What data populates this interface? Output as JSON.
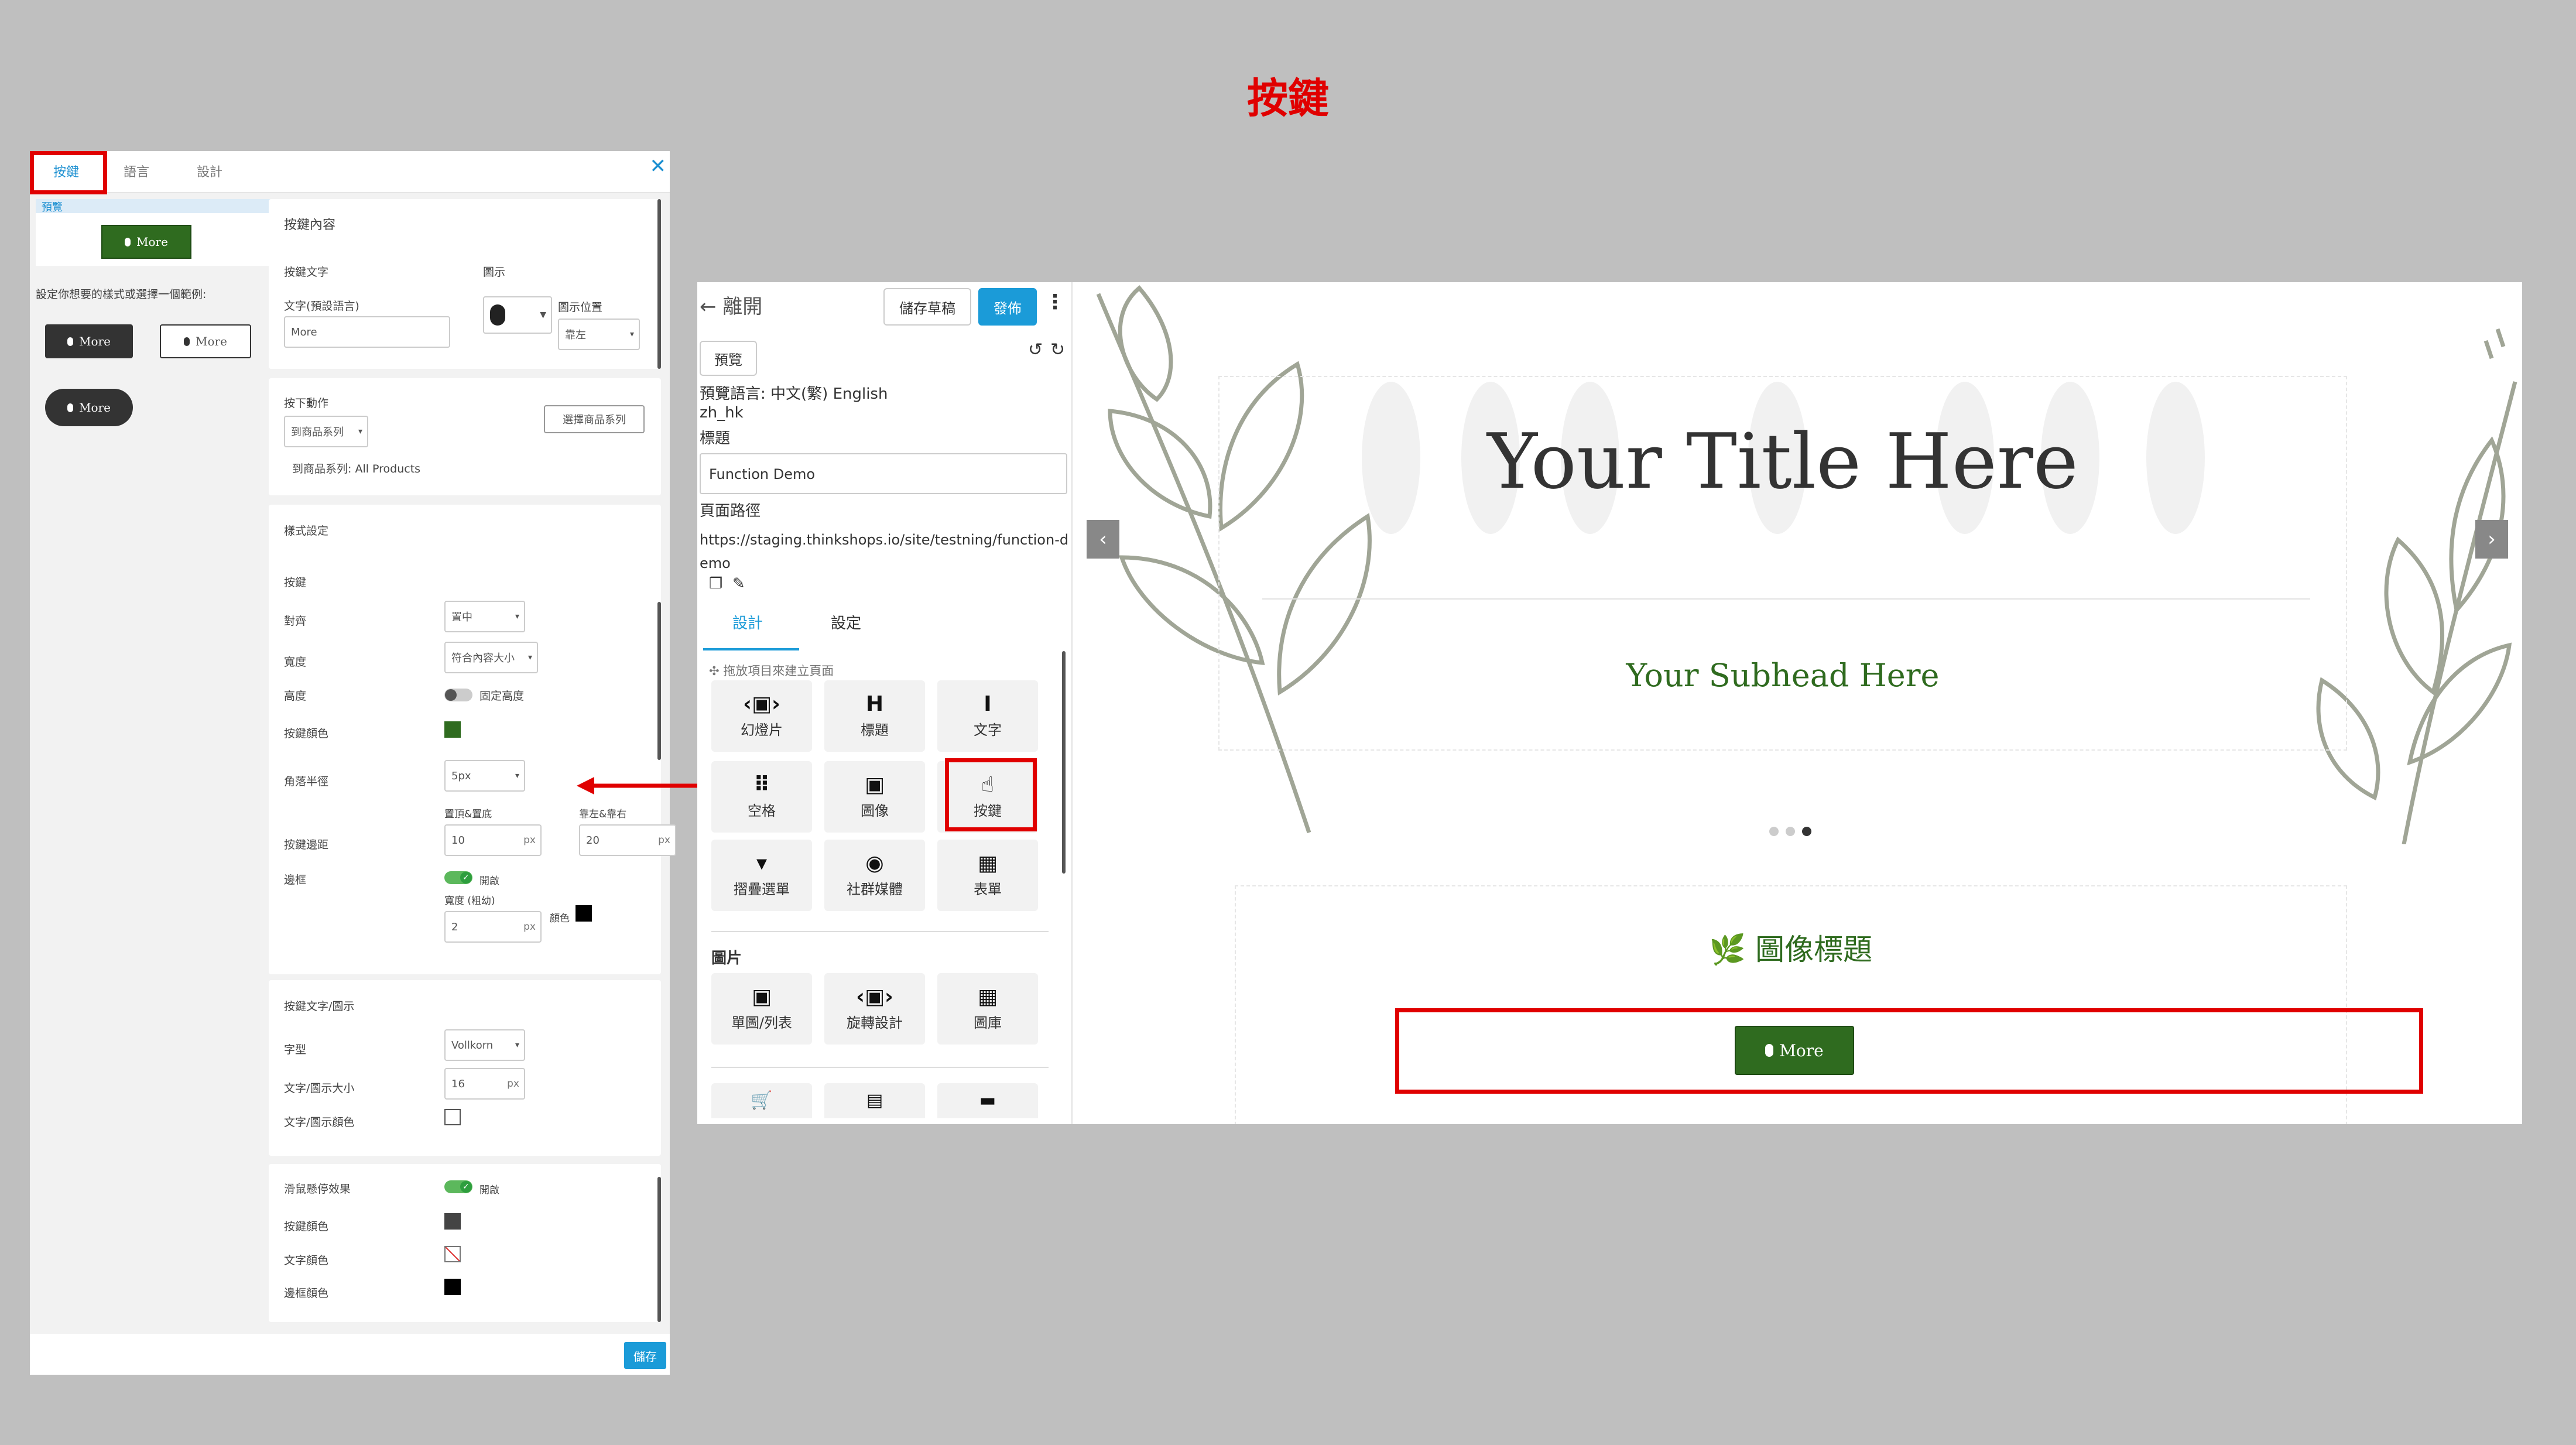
{
  "slide_title": "按鍵",
  "left_panel": {
    "tabs": [
      "按鍵",
      "語言",
      "設計"
    ],
    "close_icon": "close-icon",
    "preview_label": "預覽",
    "preview_button_label": "More",
    "style_hint": "設定你想要的樣式或選擇一個範例:",
    "sample_buttons": [
      "More",
      "More",
      "More"
    ],
    "content_card": {
      "title": "按鍵內容",
      "button_text_label": "按鍵文字",
      "text_default_label": "文字(預設語言)",
      "text_value": "More",
      "icon_label": "圖示",
      "icon_position_label": "圖示位置",
      "icon_position_value": "靠左"
    },
    "action_card": {
      "on_click_label": "按下動作",
      "action_value": "到商品系列",
      "choose_button": "選擇商品系列",
      "selected_text": "到商品系列: All Products"
    },
    "style_card": {
      "title": "樣式設定",
      "button_label": "按鍵",
      "align_label": "對齊",
      "align_value": "置中",
      "width_label": "寬度",
      "width_value": "符合內容大小",
      "height_label": "高度",
      "fixed_height_label": "固定高度",
      "button_color_label": "按鍵顏色",
      "radius_label": "角落半徑",
      "radius_value": "5px",
      "padding_tb_label": "置頂&置底",
      "padding_lr_label": "靠左&靠右",
      "padding_label": "按鍵邊距",
      "padding_tb_value": "10",
      "padding_lr_value": "20",
      "unit_px": "px",
      "border_label": "邊框",
      "border_on_label": "開啟",
      "border_width_label": "寬度 (粗幼)",
      "border_width_value": "2",
      "border_color_label": "顏色"
    },
    "font_card": {
      "title": "按鍵文字/圖示",
      "font_label": "字型",
      "font_value": "Vollkorn",
      "size_label": "文字/圖示大小",
      "size_value": "16",
      "color_label": "文字/圖示顏色"
    },
    "hover_card": {
      "hover_label": "滑鼠懸停效果",
      "hover_on_label": "開啟",
      "button_color_label": "按鍵顏色",
      "text_color_label": "文字顏色",
      "border_color_label": "邊框顏色"
    },
    "save_button": "儲存",
    "colors": {
      "green": "#2f6b1f",
      "hover_dark": "#444444",
      "black": "#000000",
      "accent": "#1b9bd8"
    }
  },
  "editor": {
    "back_label": "離開",
    "save_draft": "儲存草稿",
    "publish": "發佈",
    "preview": "預覽",
    "preview_language": "預覽語言: 中文(繁) English",
    "locale": "zh_hk",
    "title_label": "標題",
    "title_value": "Function Demo",
    "path_label": "頁面路徑",
    "path_value": "https://staging.thinkshops.io/site/testning/function-demo",
    "tabs": [
      "設計",
      "設定"
    ],
    "drag_hint": "拖放項目來建立頁面",
    "tools_row1": [
      {
        "label": "幻燈片",
        "icon": "‹▣›"
      },
      {
        "label": "標題",
        "icon": "H"
      },
      {
        "label": "文字",
        "icon": "I"
      }
    ],
    "tools_row2": [
      {
        "label": "空格",
        "icon": "⠿"
      },
      {
        "label": "圖像",
        "icon": "▣"
      },
      {
        "label": "按鍵",
        "icon": "☝"
      }
    ],
    "tools_row3": [
      {
        "label": "摺疊選單",
        "icon": "▾"
      },
      {
        "label": "社群媒體",
        "icon": "◉"
      },
      {
        "label": "表單",
        "icon": "▦"
      }
    ],
    "images_section": "圖片",
    "tools_row4": [
      {
        "label": "單圖/列表",
        "icon": "▣"
      },
      {
        "label": "旋轉設計",
        "icon": "‹▣›"
      },
      {
        "label": "圖庫",
        "icon": "▦"
      }
    ],
    "tools_row5_icons": [
      "cart-icon",
      "list-icon",
      "ticket-icon"
    ]
  },
  "canvas": {
    "title": "Your Title Here",
    "subhead": "Your Subhead Here",
    "image_heading": "🌿 圖像標題",
    "button_label": "More",
    "carousel_dots": 3,
    "carousel_active_dot": 3
  }
}
